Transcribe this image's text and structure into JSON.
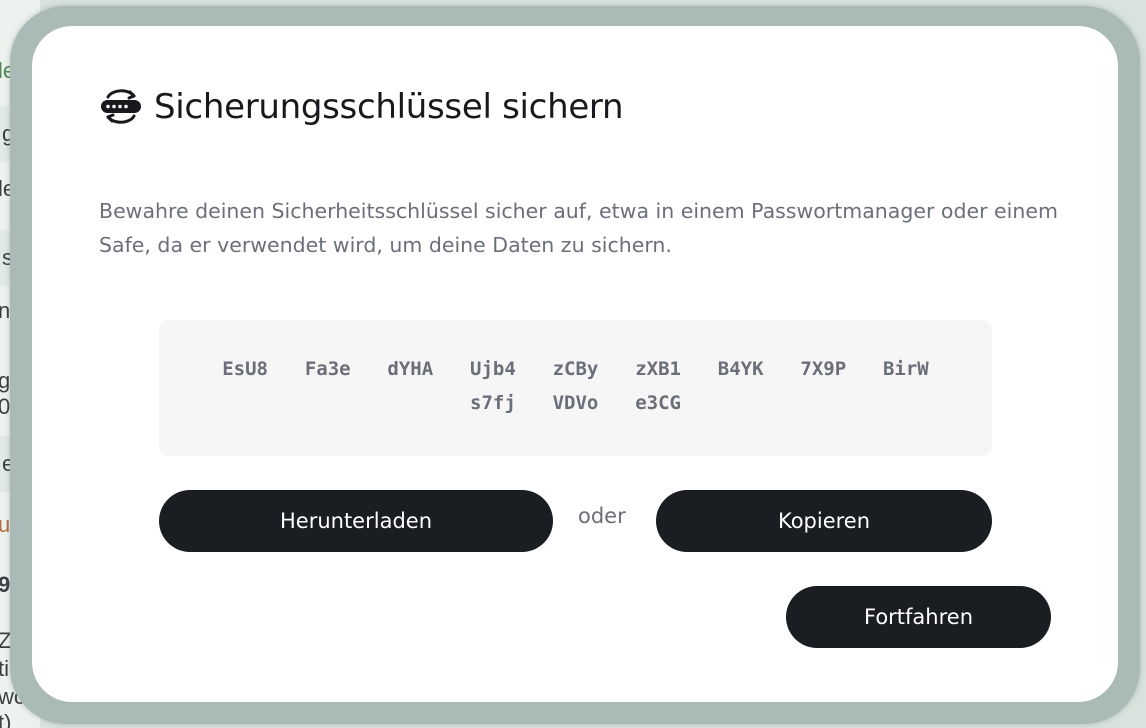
{
  "background": {
    "fragments": [
      "le",
      "g",
      "le",
      "s",
      "n",
      "g",
      "0",
      "er",
      "ue",
      "9",
      "Z",
      "ti",
      "wc",
      "t)"
    ]
  },
  "dialog": {
    "title": "Sicherungsschlüssel sichern",
    "icon": "key-backup-icon",
    "description": "Bewahre deinen Sicherheitsschlüssel sicher auf, etwa in einem Passwortmanager oder einem Safe, da er verwendet wird, um deine Daten zu sichern.",
    "key_chunks": [
      "EsU8",
      "Fa3e",
      "dYHA",
      "Ujb4",
      "zCBy",
      "zXB1",
      "B4YK",
      "7X9P",
      "BirW",
      "s7fj",
      "VDVo",
      "e3CG"
    ],
    "download_label": "Herunterladen",
    "separator": "oder",
    "copy_label": "Kopieren",
    "continue_label": "Fortfahren"
  },
  "colors": {
    "button_bg": "#1a1d22",
    "muted_text": "#6b6f7a",
    "key_box_bg": "#f6f6f6"
  }
}
